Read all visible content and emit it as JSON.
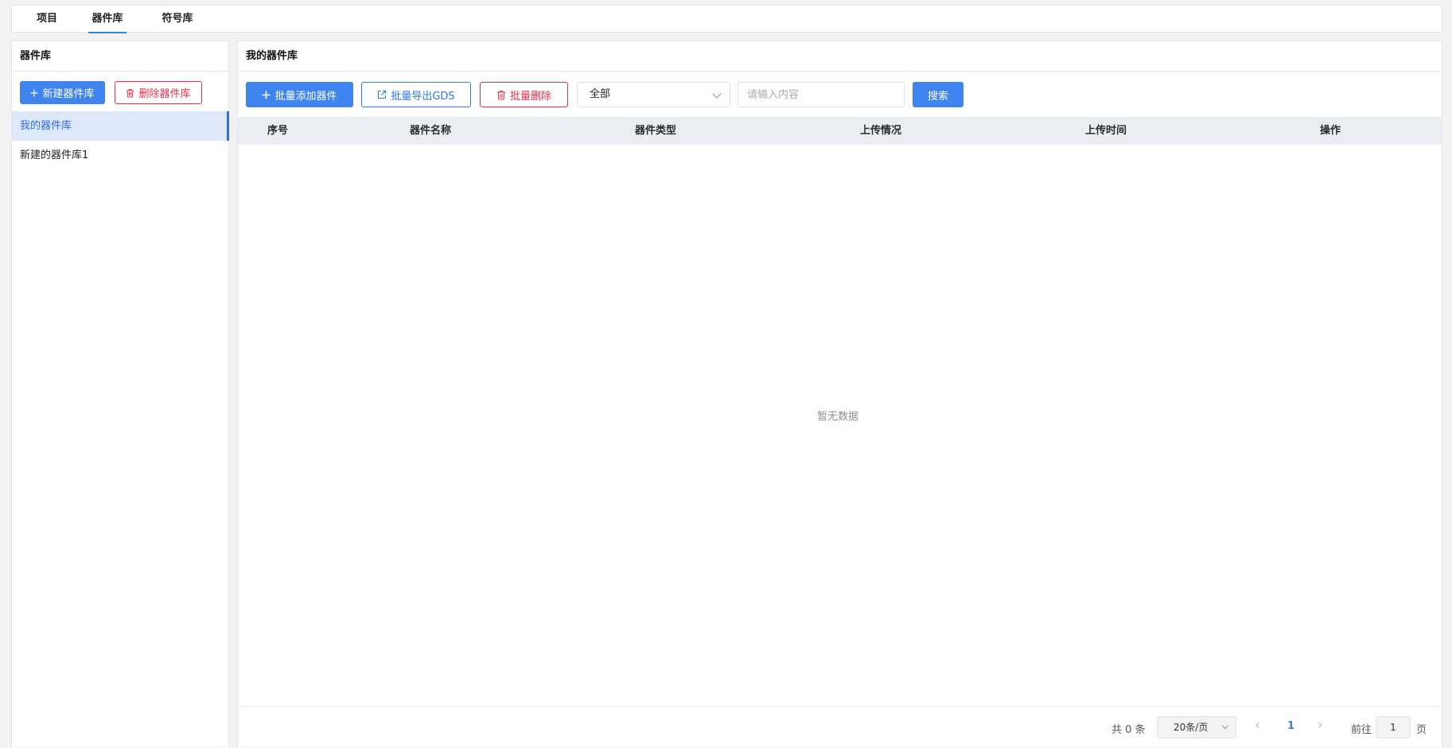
{
  "tabs": [
    {
      "label": "项目",
      "active": false
    },
    {
      "label": "器件库",
      "active": true
    },
    {
      "label": "符号库",
      "active": false
    }
  ],
  "left_panel": {
    "title": "器件库",
    "new_button": "新建器件库",
    "delete_button": "删除器件库",
    "libraries": [
      {
        "label": "我的器件库",
        "active": true
      },
      {
        "label": "新建的器件库1",
        "active": false
      }
    ]
  },
  "right_panel": {
    "title": "我的器件库",
    "toolbar": {
      "batch_add": "批量添加器件",
      "batch_export": "批量导出GDS",
      "batch_delete": "批量删除",
      "filter_value": "全部",
      "search_placeholder": "请输入内容",
      "search_button": "搜索"
    },
    "columns": [
      "序号",
      "器件名称",
      "器件类型",
      "上传情况",
      "上传时间",
      "操作"
    ],
    "empty_text": "暂无数据",
    "pagination": {
      "total": "共 0 条",
      "page_size": "20条/页",
      "current_page": "1",
      "goto_label": "前往",
      "goto_value": "1",
      "page_suffix": "页"
    }
  },
  "colors": {
    "primary": "#3f84ee",
    "danger": "#e0334f",
    "active_bg": "#dde8fb"
  }
}
